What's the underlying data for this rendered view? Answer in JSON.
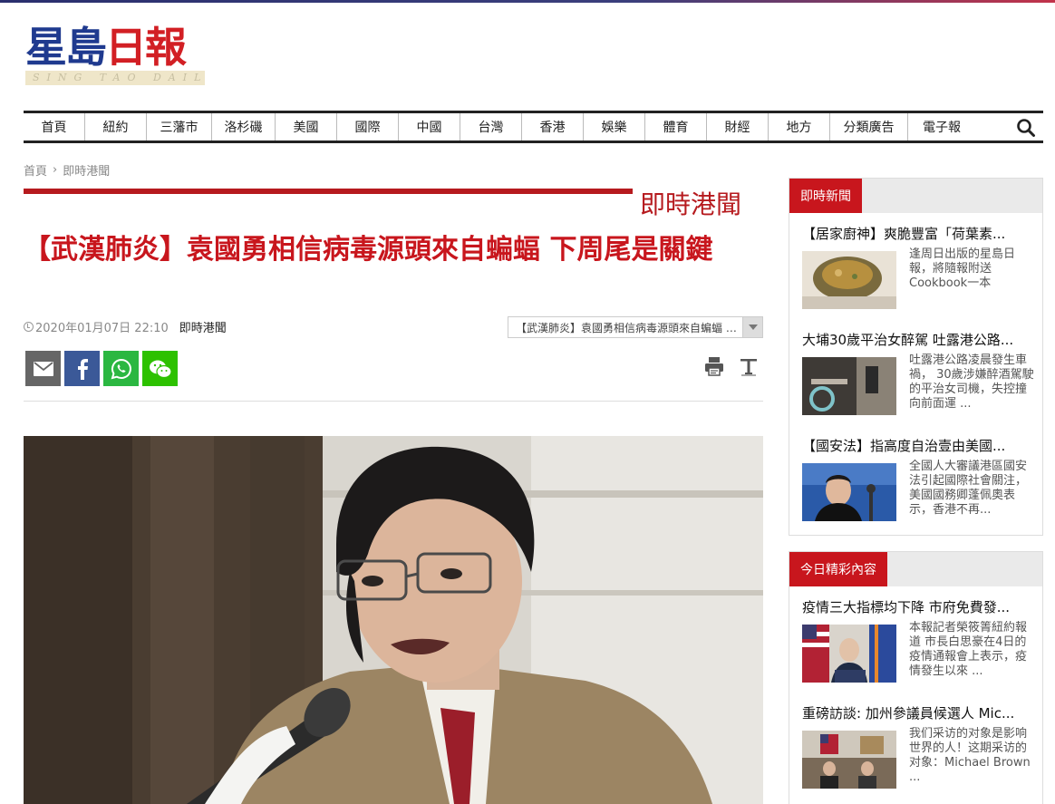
{
  "logo": {
    "cn_part1": "星島",
    "cn_part2": "日報",
    "en": "SING TAO DAILY"
  },
  "nav": {
    "items": [
      "首頁",
      "紐約",
      "三藩市",
      "洛杉磯",
      "美國",
      "國際",
      "中國",
      "台灣",
      "香港",
      "娛樂",
      "體育",
      "財經",
      "地方",
      "分類廣告",
      "電子報"
    ],
    "search_icon": "search-icon"
  },
  "breadcrumb": {
    "home": "首頁",
    "sep": "›",
    "current": "即時港聞"
  },
  "section": {
    "title": "即時港聞"
  },
  "article": {
    "headline": "【武漢肺炎】袁國勇相信病毒源頭來自蝙蝠 下周尾是關鍵",
    "datetime": "2020年01月07日 22:10",
    "category": "即時港聞",
    "related_select": "【武漢肺炎】袁國勇相信病毒源頭來自蝙蝠 下周尾是關鍵"
  },
  "share": {
    "icons": [
      "email-icon",
      "facebook-icon",
      "whatsapp-icon",
      "wechat-icon"
    ],
    "colors": {
      "email": "#666666",
      "facebook": "#3b5998",
      "whatsapp": "#2bb741",
      "wechat": "#2dc100"
    }
  },
  "tools": {
    "icons": [
      "print-icon",
      "font-size-icon"
    ]
  },
  "sidebar": {
    "latest": {
      "title": "即時新聞",
      "items": [
        {
          "title": "【居家廚神】爽脆豐富「荷葉素...",
          "desc": "逢周日出版的星島日報，將隨報附送Cookbook一本"
        },
        {
          "title": "大埔30歲平治女醉駕 吐露港公路...",
          "desc": "吐露港公路凌晨發生車禍， 30歲涉嫌醉酒駕駛的平治女司機，失控撞向前面運 ..."
        },
        {
          "title": "【國安法】指高度自治壹由美國...",
          "desc": "全國人大審議港區國安法引起國際社會關注，美國國務卿蓬佩奧表示，香港不再..."
        }
      ]
    },
    "featured": {
      "title": "今日精彩內容",
      "items": [
        {
          "title": "疫情三大指標均下降 市府免費發...",
          "desc": "本報記者榮筱箐紐約報道 市長白思豪在4日的疫情通報會上表示，疫情發生以來 ..."
        },
        {
          "title": "重磅訪談: 加州參議員候選人 Mic...",
          "desc": "我们采访的对象是影响世界的人！这期采访的对象：Michael Brown ..."
        }
      ]
    }
  },
  "accent_color": "#c8161d"
}
